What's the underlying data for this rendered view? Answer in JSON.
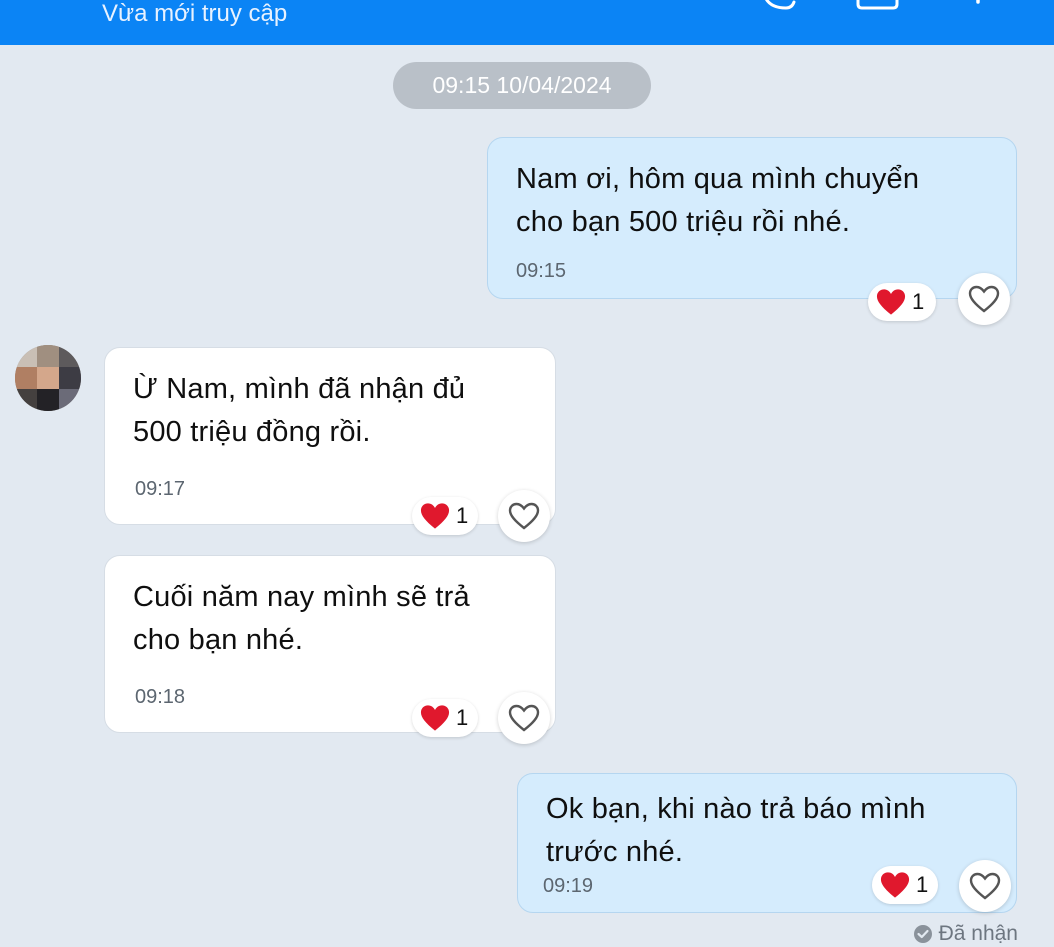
{
  "header": {
    "subtitle": "Vừa mới truy cập",
    "background": "#0b84f5"
  },
  "date_separator": "09:15 10/04/2024",
  "messages": [
    {
      "direction": "outgoing",
      "text_lines": [
        "Nam ơi, hôm qua mình chuyển",
        "cho bạn 500 triệu rồi nhé."
      ],
      "time": "09:15",
      "reaction": {
        "emoji": "heart",
        "count": "1"
      }
    },
    {
      "direction": "incoming",
      "text_lines": [
        "Ừ Nam, mình đã nhận đủ",
        "500 triệu đồng rồi."
      ],
      "time": "09:17",
      "reaction": {
        "emoji": "heart",
        "count": "1"
      }
    },
    {
      "direction": "incoming",
      "text_lines": [
        "Cuối năm nay mình sẽ trả",
        "cho bạn nhé."
      ],
      "time": "09:18",
      "reaction": {
        "emoji": "heart",
        "count": "1"
      }
    },
    {
      "direction": "outgoing",
      "text_lines": [
        "Ok bạn, khi nào trả báo mình",
        "trước nhé."
      ],
      "time": "09:19",
      "reaction": {
        "emoji": "heart",
        "count": "1"
      }
    }
  ],
  "status": "Đã nhận",
  "colors": {
    "outgoing_bubble": "#d5ecfd",
    "incoming_bubble": "#ffffff",
    "chat_background": "#e2e9f1",
    "heart": "#e0182d"
  }
}
